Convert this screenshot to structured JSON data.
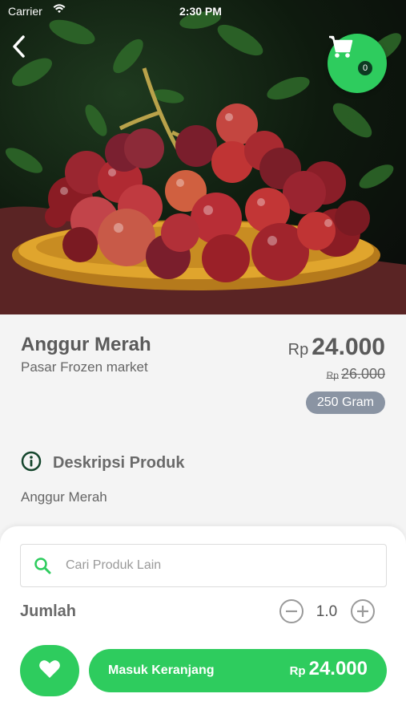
{
  "status_bar": {
    "carrier": "Carrier",
    "time": "2:30 PM"
  },
  "header": {
    "back_icon": "chevron-left-icon",
    "cart_icon": "cart-icon",
    "cart_count": "0"
  },
  "product": {
    "name": "Anggur Merah",
    "store": "Pasar Frozen market",
    "price_currency": "Rp",
    "price": "24.000",
    "old_price_currency": "Rp",
    "old_price": "26.000",
    "unit": "250 Gram"
  },
  "description": {
    "title": "Deskripsi Produk",
    "text": "Anggur Merah",
    "icon": "info-icon"
  },
  "search": {
    "placeholder": "Cari Produk Lain",
    "icon": "search-icon"
  },
  "quantity": {
    "label": "Jumlah",
    "value": "1.0",
    "minus_icon": "minus-circle-icon",
    "plus_icon": "plus-circle-icon"
  },
  "actions": {
    "favorite_icon": "heart-icon",
    "add_to_cart_label": "Masuk Keranjang",
    "add_to_cart_currency": "Rp",
    "add_to_cart_price": "24.000"
  },
  "colors": {
    "accent": "#2ecc5e",
    "badge": "#8a94a3",
    "text": "#5a5a5a"
  }
}
